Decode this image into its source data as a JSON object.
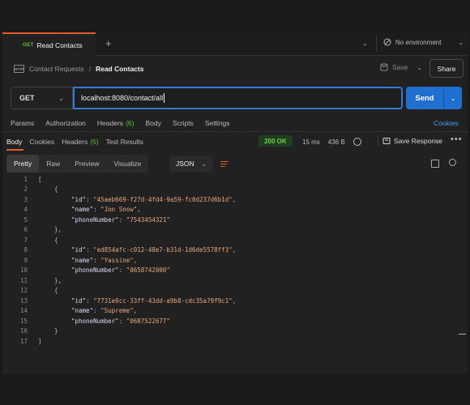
{
  "tab": {
    "method": "GET",
    "title": "Read Contacts",
    "add": "+",
    "chevron": "⌄"
  },
  "environment": {
    "label": "No environment",
    "chevron": "⌄"
  },
  "breadcrumb": {
    "icon": "HTTP",
    "parent": "Contact Requests",
    "separator": "/",
    "current": "Read Contacts"
  },
  "actions": {
    "save": "Save",
    "save_chevron": "⌄",
    "share": "Share"
  },
  "request": {
    "method": "GET",
    "method_chevron": "⌄",
    "url": "localhost:8080/contact/all",
    "send": "Send",
    "send_chevron": "⌄"
  },
  "request_tabs": {
    "params": "Params",
    "authorization": "Authorization",
    "headers": "Headers",
    "headers_count": "(6)",
    "body": "Body",
    "scripts": "Scripts",
    "settings": "Settings",
    "cookies": "Cookies"
  },
  "response_tabs": {
    "body": "Body",
    "cookies": "Cookies",
    "headers": "Headers",
    "headers_count": "(5)",
    "test_results": "Test Results"
  },
  "response_meta": {
    "status": "200 OK",
    "time": "15 ms",
    "size": "436 B",
    "save_response": "Save Response",
    "more": "•••"
  },
  "view": {
    "modes": [
      "Pretty",
      "Raw",
      "Preview",
      "Visualize"
    ],
    "active": "Pretty",
    "format": "JSON",
    "format_chevron": "⌄"
  },
  "code_lines": [
    {
      "n": "1",
      "indent": 0,
      "parts": [
        [
          "p",
          "["
        ]
      ]
    },
    {
      "n": "2",
      "indent": 1,
      "parts": [
        [
          "p",
          "{"
        ]
      ]
    },
    {
      "n": "3",
      "indent": 2,
      "parts": [
        [
          "k",
          "\"id\""
        ],
        [
          "p",
          ": "
        ],
        [
          "s",
          "\"45aeb669-f27d-4fd4-9a59-fc0d237d6b1d\""
        ],
        [
          "p",
          ","
        ]
      ]
    },
    {
      "n": "4",
      "indent": 2,
      "parts": [
        [
          "k",
          "\"name\""
        ],
        [
          "p",
          ": "
        ],
        [
          "s",
          "\"Jon Snow\""
        ],
        [
          "p",
          ","
        ]
      ]
    },
    {
      "n": "5",
      "indent": 2,
      "parts": [
        [
          "k",
          "\"phoneNumber\""
        ],
        [
          "p",
          ": "
        ],
        [
          "s",
          "\"7543454321\""
        ]
      ]
    },
    {
      "n": "6",
      "indent": 1,
      "parts": [
        [
          "p",
          "},"
        ]
      ]
    },
    {
      "n": "7",
      "indent": 1,
      "parts": [
        [
          "p",
          "{"
        ]
      ]
    },
    {
      "n": "8",
      "indent": 2,
      "parts": [
        [
          "k",
          "\"id\""
        ],
        [
          "p",
          ": "
        ],
        [
          "s",
          "\"ed854afc-c012-48e7-b31d-1d6de5578ff3\""
        ],
        [
          "p",
          ","
        ]
      ]
    },
    {
      "n": "9",
      "indent": 2,
      "parts": [
        [
          "k",
          "\"name\""
        ],
        [
          "p",
          ": "
        ],
        [
          "s",
          "\"Yassine\""
        ],
        [
          "p",
          ","
        ]
      ]
    },
    {
      "n": "10",
      "indent": 2,
      "parts": [
        [
          "k",
          "\"phoneNumber\""
        ],
        [
          "p",
          ": "
        ],
        [
          "s",
          "\"0658742000\""
        ]
      ]
    },
    {
      "n": "11",
      "indent": 1,
      "parts": [
        [
          "p",
          "},"
        ]
      ]
    },
    {
      "n": "12",
      "indent": 1,
      "parts": [
        [
          "p",
          "{"
        ]
      ]
    },
    {
      "n": "13",
      "indent": 2,
      "parts": [
        [
          "k",
          "\"id\""
        ],
        [
          "p",
          ": "
        ],
        [
          "s",
          "\"7731e0cc-33ff-43dd-a9b8-cdc35a79f9c1\""
        ],
        [
          "p",
          ","
        ]
      ]
    },
    {
      "n": "14",
      "indent": 2,
      "parts": [
        [
          "k",
          "\"name\""
        ],
        [
          "p",
          ": "
        ],
        [
          "s",
          "\"Supreme\""
        ],
        [
          "p",
          ","
        ]
      ]
    },
    {
      "n": "15",
      "indent": 2,
      "parts": [
        [
          "k",
          "\"phoneNumber\""
        ],
        [
          "p",
          ": "
        ],
        [
          "s",
          "\"0687522677\""
        ]
      ]
    },
    {
      "n": "16",
      "indent": 1,
      "parts": [
        [
          "p",
          "}"
        ]
      ]
    },
    {
      "n": "17",
      "indent": 0,
      "parts": [
        [
          "p",
          "]"
        ]
      ]
    }
  ],
  "colors": {
    "accent": "#e05a2b",
    "send": "#1f6fd0",
    "status_ok": "#6fd14a",
    "method_get": "#5fbf3a"
  },
  "icons": [
    "plus-icon",
    "chevron-down-icon",
    "no-environment-icon",
    "http-icon",
    "save-icon",
    "globe-icon",
    "save-response-icon",
    "more-icon",
    "wrap-icon",
    "copy-icon",
    "search-icon"
  ]
}
